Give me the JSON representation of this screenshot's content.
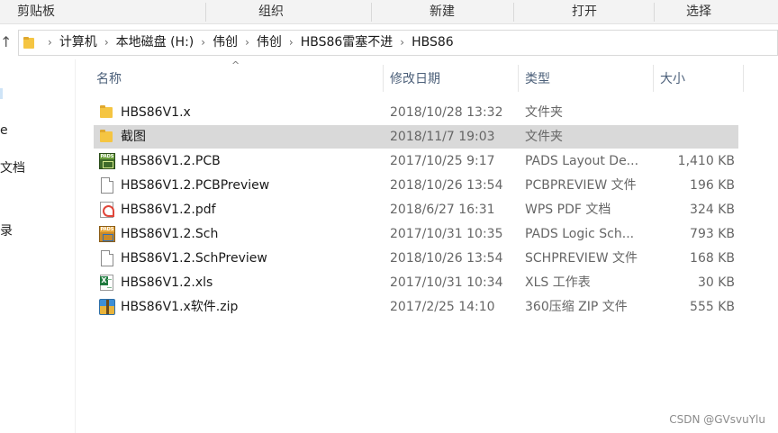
{
  "ribbon": {
    "groups": [
      "剪贴板",
      "组织",
      "新建",
      "打开",
      "选择"
    ]
  },
  "address": {
    "up_glyph": "↑",
    "crumbs": [
      "计算机",
      "本地磁盘 (H:)",
      "伟创",
      "伟创",
      "HBS86雷塞不进",
      "HBS86"
    ]
  },
  "nav": {
    "items": [
      "e",
      "文档",
      "录"
    ]
  },
  "columns": {
    "sort_glyph": "^",
    "name": "名称",
    "date": "修改日期",
    "type": "类型",
    "size": "大小"
  },
  "files": [
    {
      "name": "HBS86V1.x",
      "date": "2018/10/28 13:32",
      "type": "文件夹",
      "size": "",
      "icon": "folder-icon",
      "selected": false
    },
    {
      "name": "截图",
      "date": "2018/11/7 19:03",
      "type": "文件夹",
      "size": "",
      "icon": "folder-icon",
      "selected": true
    },
    {
      "name": "HBS86V1.2.PCB",
      "date": "2017/10/25 9:17",
      "type": "PADS Layout De...",
      "size": "1,410 KB",
      "icon": "pads-layout-icon",
      "selected": false
    },
    {
      "name": "HBS86V1.2.PCBPreview",
      "date": "2018/10/26 13:54",
      "type": "PCBPREVIEW 文件",
      "size": "196 KB",
      "icon": "blank-file-icon",
      "selected": false
    },
    {
      "name": "HBS86V1.2.pdf",
      "date": "2018/6/27 16:31",
      "type": "WPS PDF 文档",
      "size": "324 KB",
      "icon": "pdf-icon",
      "selected": false
    },
    {
      "name": "HBS86V1.2.Sch",
      "date": "2017/10/31 10:35",
      "type": "PADS Logic Sch...",
      "size": "793 KB",
      "icon": "pads-logic-icon",
      "selected": false
    },
    {
      "name": "HBS86V1.2.SchPreview",
      "date": "2018/10/26 13:54",
      "type": "SCHPREVIEW 文件",
      "size": "168 KB",
      "icon": "blank-file-icon",
      "selected": false
    },
    {
      "name": "HBS86V1.2.xls",
      "date": "2017/10/31 10:34",
      "type": "XLS 工作表",
      "size": "30 KB",
      "icon": "excel-icon",
      "selected": false
    },
    {
      "name": "HBS86V1.x软件.zip",
      "date": "2017/2/25 14:10",
      "type": "360压缩 ZIP 文件",
      "size": "555 KB",
      "icon": "zip-archive-icon",
      "selected": false
    }
  ],
  "watermark": "CSDN @GVsvuYlu"
}
